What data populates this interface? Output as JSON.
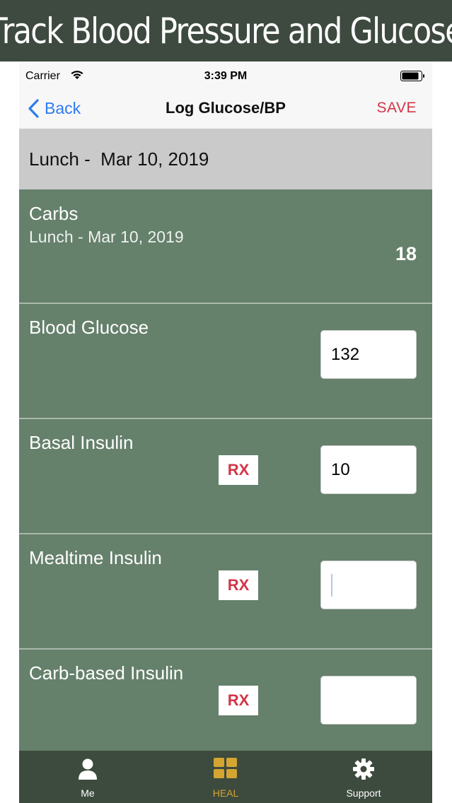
{
  "banner": {
    "title": "Track Blood Pressure and Glucose"
  },
  "status_bar": {
    "carrier": "Carrier",
    "time": "3:39 PM"
  },
  "nav": {
    "back_label": "Back",
    "title": "Log Glucose/BP",
    "save_label": "SAVE"
  },
  "section_header": "Lunch -  Mar 10, 2019",
  "carbs": {
    "title": "Carbs",
    "subtitle": "Lunch - Mar 10, 2019",
    "value": "18"
  },
  "rows": [
    {
      "title": "Blood Glucose",
      "value": "132",
      "rx": ""
    },
    {
      "title": "Basal Insulin",
      "value": "10",
      "rx": "RX"
    },
    {
      "title": "Mealtime Insulin",
      "value": "",
      "rx": "RX"
    },
    {
      "title": "Carb-based Insulin",
      "value": "",
      "rx": "RX"
    }
  ],
  "tabs": [
    {
      "label": "Me",
      "icon": "person-icon",
      "active": false
    },
    {
      "label": "HEAL",
      "icon": "grid-icon",
      "active": true
    },
    {
      "label": "Support",
      "icon": "gear-icon",
      "active": false
    }
  ],
  "colors": {
    "banner_bg": "#3e4a3f",
    "row_bg": "#65806b",
    "accent_blue": "#2d7cf0",
    "accent_red": "#d23547",
    "tab_active": "#d4a531"
  }
}
